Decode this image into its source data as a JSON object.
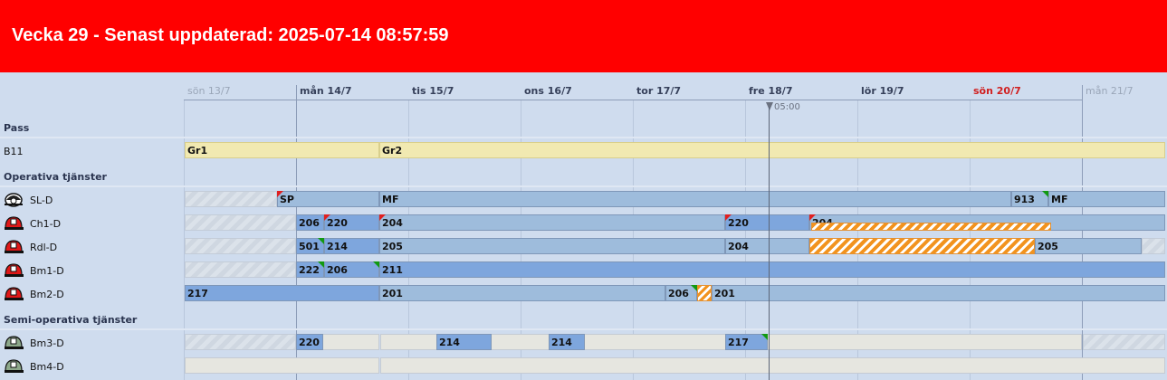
{
  "header": {
    "title": "Vecka 29 - Senast uppdaterad: 2025-07-14 08:57:59",
    "bg_color": "#ff0000"
  },
  "days": [
    {
      "label": "sön 13/7",
      "style": "dim"
    },
    {
      "label": "mån 14/7",
      "style": "normal"
    },
    {
      "label": "tis 15/7",
      "style": "normal"
    },
    {
      "label": "ons 16/7",
      "style": "normal"
    },
    {
      "label": "tor 17/7",
      "style": "normal"
    },
    {
      "label": "fre 18/7",
      "style": "normal"
    },
    {
      "label": "lör 19/7",
      "style": "normal"
    },
    {
      "label": "sön 20/7",
      "style": "red"
    },
    {
      "label": "mån 21/7",
      "style": "dim"
    }
  ],
  "now_marker": {
    "time": "05:00"
  },
  "sections": {
    "pass": "Pass",
    "operative": "Operativa tjänster",
    "semi": "Semi-operativa tjänster"
  },
  "rows": {
    "b11": {
      "label": "B11",
      "bars": [
        "Gr1",
        "Gr2"
      ]
    },
    "sl_d": {
      "label": "SL-D",
      "icon": "helmet-icon",
      "bars": [
        "SP",
        "MF",
        "913",
        "MF"
      ]
    },
    "ch1_d": {
      "label": "Ch1-D",
      "icon": "fire-helmet-icon",
      "bars": [
        "206",
        "220",
        "204",
        "220",
        "204"
      ]
    },
    "rdl_d": {
      "label": "Rdl-D",
      "icon": "fire-helmet-icon",
      "bars": [
        "501",
        "214",
        "205",
        "204",
        "205"
      ]
    },
    "bm1_d": {
      "label": "Bm1-D",
      "icon": "fire-helmet-icon",
      "bars": [
        "222",
        "206",
        "211"
      ]
    },
    "bm2_d": {
      "label": "Bm2-D",
      "icon": "fire-helmet-icon",
      "bars": [
        "217",
        "201",
        "206",
        "201"
      ]
    },
    "bm3_d": {
      "label": "Bm3-D",
      "icon": "semi-helmet-icon",
      "bars": [
        "220",
        "214",
        "214",
        "217"
      ]
    },
    "bm4_d": {
      "label": "Bm4-D",
      "icon": "semi-helmet-icon",
      "bars": []
    }
  },
  "colors": {
    "background": "#cfdcee",
    "bar_pale": "#9ebcdc",
    "bar_mid": "#7ea6dd",
    "pass_yellow": "#f1e9b1",
    "semi_grey": "#e6e6e0",
    "flag_red": "#e02020",
    "flag_green": "#119911",
    "orange_hatch": "#f2931e"
  }
}
